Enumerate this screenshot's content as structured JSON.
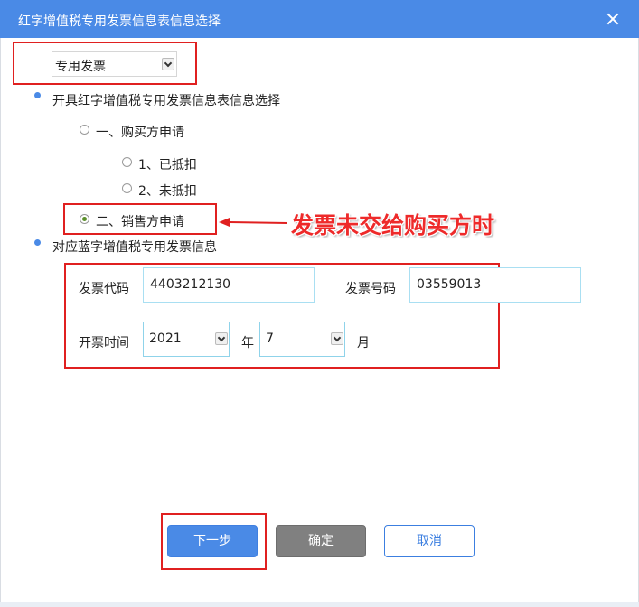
{
  "dialog": {
    "title": "红字增值税专用发票信息表信息选择",
    "invoice_type": {
      "selected": "专用发票"
    },
    "section1": {
      "label": "开具红字增值税专用发票信息表信息选择",
      "buyer_apply": {
        "label": "一、购买方申请",
        "checked": false
      },
      "deducted": {
        "label": "1、已抵扣",
        "checked": false
      },
      "not_deducted": {
        "label": "2、未抵扣",
        "checked": false
      },
      "seller_apply": {
        "label": "二、销售方申请",
        "checked": true
      }
    },
    "annotation": "发票未交给购买方时",
    "section2": {
      "label": "对应蓝字增值税专用发票信息",
      "invoice_code_label": "发票代码",
      "invoice_code_value": "4403212130",
      "invoice_number_label": "发票号码",
      "invoice_number_value": "03559013",
      "issue_time_label": "开票时间",
      "year_value": "2021",
      "year_unit": "年",
      "month_value": "7",
      "month_unit": "月"
    },
    "buttons": {
      "next": "下一步",
      "ok": "确定",
      "cancel": "取消"
    }
  },
  "colors": {
    "titlebar": "#4a8ae6",
    "highlight_box": "#e02020",
    "primary_button": "#4a8ae6",
    "disabled_button": "#808080",
    "field_border": "#a9dff2"
  }
}
